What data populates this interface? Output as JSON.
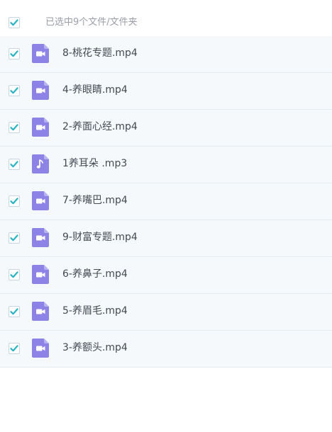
{
  "header": {
    "select_all_checked": true,
    "label": "已选中9个文件/文件夹"
  },
  "colors": {
    "checkmark": "#2ab3c4",
    "file_icon": "#8d83e6",
    "row_background": "#f5f9fc",
    "row_border": "#e3eaf0"
  },
  "files": [
    {
      "name": "8-桃花专题.mp4",
      "icon": "video-file-icon",
      "checked": true
    },
    {
      "name": "4-养眼睛.mp4",
      "icon": "video-file-icon",
      "checked": true
    },
    {
      "name": "2-养面心经.mp4",
      "icon": "video-file-icon",
      "checked": true
    },
    {
      "name": "1养耳朵 .mp3",
      "icon": "audio-file-icon",
      "checked": true
    },
    {
      "name": "7-养嘴巴.mp4",
      "icon": "video-file-icon",
      "checked": true
    },
    {
      "name": "9-财富专题.mp4",
      "icon": "video-file-icon",
      "checked": true
    },
    {
      "name": "6-养鼻子.mp4",
      "icon": "video-file-icon",
      "checked": true
    },
    {
      "name": "5-养眉毛.mp4",
      "icon": "video-file-icon",
      "checked": true
    },
    {
      "name": "3-养额头.mp4",
      "icon": "video-file-icon",
      "checked": true
    }
  ]
}
